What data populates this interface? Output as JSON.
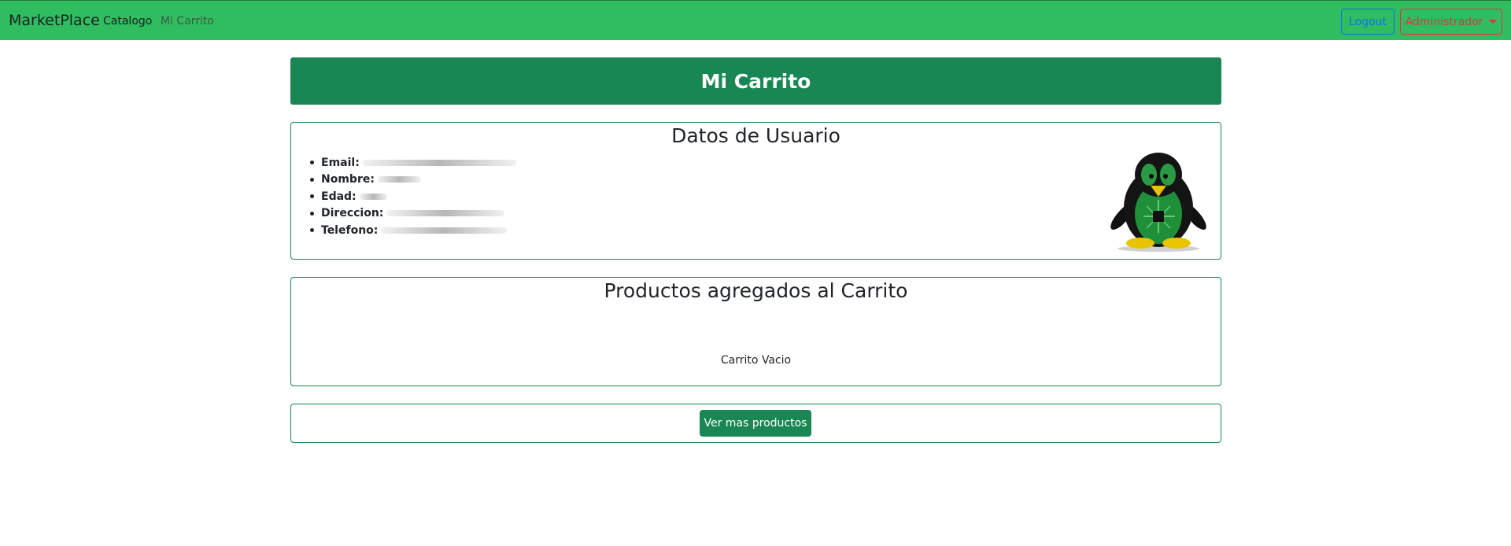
{
  "navbar": {
    "brand": "MarketPlace",
    "links": [
      "Catalogo",
      "Mi Carrito"
    ],
    "logout_label": "Logout",
    "admin_label": "Administrador"
  },
  "header": {
    "title": "Mi Carrito"
  },
  "user_card": {
    "title": "Datos de Usuario",
    "fields": [
      {
        "label": "Email:",
        "value": ""
      },
      {
        "label": "Nombre:",
        "value": ""
      },
      {
        "label": "Edad:",
        "value": ""
      },
      {
        "label": "Direccion:",
        "value": ""
      },
      {
        "label": "Telefono:",
        "value": ""
      }
    ],
    "avatar_icon": "penguin-avatar-icon"
  },
  "products_card": {
    "title": "Productos agregados al Carrito",
    "empty_text": "Carrito Vacio"
  },
  "actions": {
    "more_products_label": "Ver mas productos"
  },
  "colors": {
    "navbar": "#2fbd5f",
    "primary_green": "#198754",
    "logout": "#0d6efd",
    "admin": "#dc3545"
  }
}
